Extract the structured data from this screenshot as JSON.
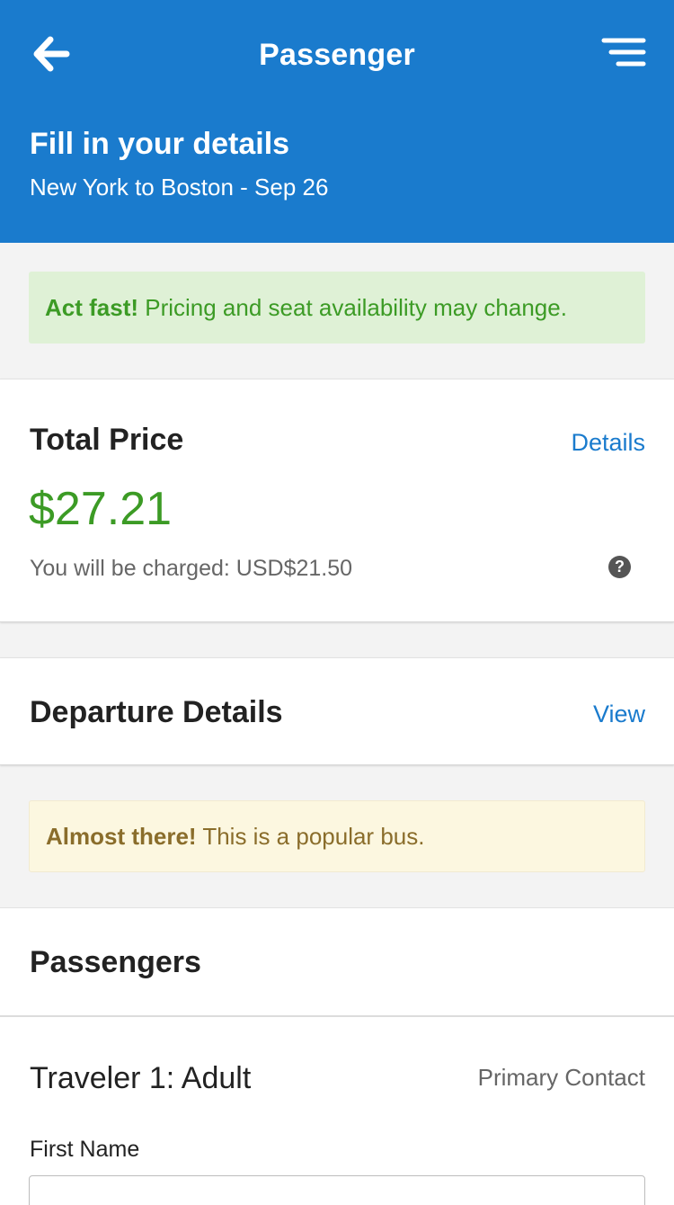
{
  "header": {
    "nav_title": "Passenger",
    "back_icon": "arrow-left-icon",
    "menu_icon": "menu-icon",
    "title": "Fill in your details",
    "subtitle": "New York to Boston - Sep 26",
    "color": "#1a7bcd"
  },
  "alerts": {
    "green": {
      "strong": "Act fast!",
      "text": " Pricing and seat availability may change."
    },
    "yellow": {
      "strong": "Almost there!",
      "text": " This is a popular bus."
    }
  },
  "price": {
    "title": "Total Price",
    "details_link": "Details",
    "amount": "$27.21",
    "charged": "You will be charged: USD$21.50",
    "help_glyph": "?",
    "help_icon": "question-circle-icon"
  },
  "departure": {
    "title": "Departure Details",
    "view_link": "View"
  },
  "passengers": {
    "title": "Passengers",
    "traveler": "Traveler 1: Adult",
    "primary_contact": "Primary Contact",
    "first_name_label": "First Name",
    "first_name_value": ""
  },
  "colors": {
    "accent": "#1a7bcd",
    "success": "#3c9b25",
    "warning_text": "#8a6d2b"
  }
}
